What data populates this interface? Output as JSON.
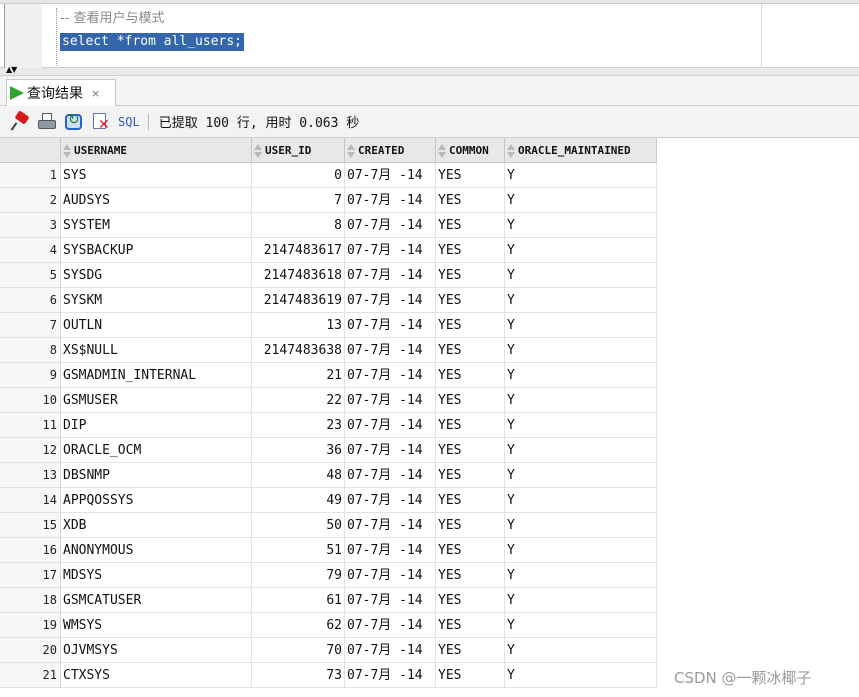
{
  "editor": {
    "comment_line": "-- 查看用户与模式",
    "query_line": "select *from all_users;"
  },
  "results_tab": {
    "label": "查询结果",
    "close": "×"
  },
  "toolbar": {
    "sql_label": "SQL",
    "status": "已提取 100 行, 用时 0.063 秒",
    "icons": [
      "pin-icon",
      "print-icon",
      "refresh-icon",
      "clear-icon"
    ]
  },
  "grid": {
    "columns": [
      "USERNAME",
      "USER_ID",
      "CREATED",
      "COMMON",
      "ORACLE_MAINTAINED"
    ],
    "rows": [
      [
        "1",
        "SYS",
        "0",
        "07-7月 -14",
        "YES",
        "Y"
      ],
      [
        "2",
        "AUDSYS",
        "7",
        "07-7月 -14",
        "YES",
        "Y"
      ],
      [
        "3",
        "SYSTEM",
        "8",
        "07-7月 -14",
        "YES",
        "Y"
      ],
      [
        "4",
        "SYSBACKUP",
        "2147483617",
        "07-7月 -14",
        "YES",
        "Y"
      ],
      [
        "5",
        "SYSDG",
        "2147483618",
        "07-7月 -14",
        "YES",
        "Y"
      ],
      [
        "6",
        "SYSKM",
        "2147483619",
        "07-7月 -14",
        "YES",
        "Y"
      ],
      [
        "7",
        "OUTLN",
        "13",
        "07-7月 -14",
        "YES",
        "Y"
      ],
      [
        "8",
        "XS$NULL",
        "2147483638",
        "07-7月 -14",
        "YES",
        "Y"
      ],
      [
        "9",
        "GSMADMIN_INTERNAL",
        "21",
        "07-7月 -14",
        "YES",
        "Y"
      ],
      [
        "10",
        "GSMUSER",
        "22",
        "07-7月 -14",
        "YES",
        "Y"
      ],
      [
        "11",
        "DIP",
        "23",
        "07-7月 -14",
        "YES",
        "Y"
      ],
      [
        "12",
        "ORACLE_OCM",
        "36",
        "07-7月 -14",
        "YES",
        "Y"
      ],
      [
        "13",
        "DBSNMP",
        "48",
        "07-7月 -14",
        "YES",
        "Y"
      ],
      [
        "14",
        "APPQOSSYS",
        "49",
        "07-7月 -14",
        "YES",
        "Y"
      ],
      [
        "15",
        "XDB",
        "50",
        "07-7月 -14",
        "YES",
        "Y"
      ],
      [
        "16",
        "ANONYMOUS",
        "51",
        "07-7月 -14",
        "YES",
        "Y"
      ],
      [
        "17",
        "MDSYS",
        "79",
        "07-7月 -14",
        "YES",
        "Y"
      ],
      [
        "18",
        "GSMCATUSER",
        "61",
        "07-7月 -14",
        "YES",
        "Y"
      ],
      [
        "19",
        "WMSYS",
        "62",
        "07-7月 -14",
        "YES",
        "Y"
      ],
      [
        "20",
        "OJVMSYS",
        "70",
        "07-7月 -14",
        "YES",
        "Y"
      ],
      [
        "21",
        "CTXSYS",
        "73",
        "07-7月 -14",
        "YES",
        "Y"
      ]
    ]
  },
  "watermark": "CSDN @一颗冰椰子",
  "colors": {
    "selection": "#3366aa",
    "run_arrow": "#2fa52f",
    "sql_blue": "#2e56c8"
  }
}
